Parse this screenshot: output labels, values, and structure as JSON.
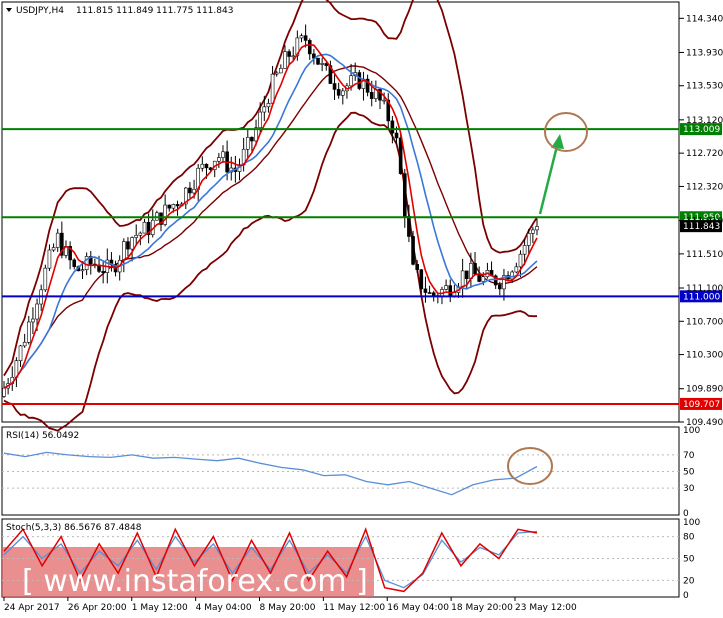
{
  "header": {
    "symbol": "USDJPY,H4",
    "ohlc": "111.815 111.849 111.775 111.843",
    "rsi": "RSI(14) 56.0492",
    "stoch": "Stoch(5,3,3) 86.5676 87.4848"
  },
  "watermark": "[ www.instaforex.com ]",
  "colors": {
    "resistance": "#008000",
    "support_blue": "#0000c8",
    "support_red": "#e00000",
    "candle": "#000000",
    "ma_fast": "#e00000",
    "ma_slow": "#3a78d8",
    "bollinger": "#7a0000",
    "rsi_line": "#5a8fd6",
    "stoch_main": "#e00000",
    "stoch_signal": "#5a8fd6",
    "arrow": "#22aa44",
    "circle": "#b07850",
    "watermark_band": "#e06060"
  },
  "chart_data": {
    "type": "candlestick",
    "price_axis": {
      "ylim": [
        109.49,
        114.5
      ],
      "ticks": [
        "114.340",
        "113.930",
        "113.530",
        "113.120",
        "112.720",
        "112.320",
        "111.910",
        "111.510",
        "111.100",
        "110.700",
        "110.300",
        "109.890",
        "109.490"
      ]
    },
    "levels": [
      {
        "value": 113.009,
        "label": "113.009",
        "color_key": "resistance"
      },
      {
        "value": 111.95,
        "label": "111.950",
        "color_key": "resistance"
      },
      {
        "value": 111.843,
        "label": "111.843",
        "color_key": "current"
      },
      {
        "value": 111.0,
        "label": "111.000",
        "color_key": "support_blue"
      },
      {
        "value": 109.707,
        "label": "109.707",
        "color_key": "support_red"
      }
    ],
    "x_labels": [
      "24 Apr 2017",
      "26 Apr 20:00",
      "1 May 12:00",
      "4 May 04:00",
      "8 May 20:00",
      "11 May 12:00",
      "16 May 04:00",
      "18 May 20:00",
      "23 May 12:00"
    ],
    "close_path": [
      109.9,
      110.4,
      111.1,
      111.7,
      111.3,
      111.4,
      111.3,
      111.7,
      111.8,
      112.0,
      112.2,
      112.5,
      112.7,
      112.5,
      112.9,
      113.5,
      113.9,
      114.1,
      113.7,
      113.5,
      113.6,
      113.4,
      113.0,
      111.3,
      111.0,
      111.1,
      111.3,
      111.2,
      111.2,
      111.5,
      111.9
    ],
    "rsi": {
      "label": "RSI(14) 56.0492",
      "ylim": [
        0,
        100
      ],
      "ticks": [
        "100",
        "70",
        "50",
        "30",
        "0"
      ],
      "values": [
        72,
        68,
        73,
        70,
        68,
        67,
        70,
        66,
        67,
        65,
        63,
        66,
        60,
        55,
        52,
        45,
        46,
        38,
        34,
        38,
        30,
        22,
        34,
        40,
        42,
        56
      ]
    },
    "stoch": {
      "label": "Stoch(5,3,3) 86.5676 87.4848",
      "ylim": [
        0,
        100
      ],
      "ticks": [
        "100",
        "80",
        "50",
        "20",
        "0"
      ],
      "main": [
        60,
        90,
        40,
        80,
        20,
        70,
        30,
        85,
        25,
        90,
        40,
        80,
        20,
        75,
        30,
        85,
        20,
        60,
        25,
        90,
        10,
        5,
        30,
        85,
        40,
        70,
        50,
        90,
        85
      ],
      "signal": [
        55,
        80,
        50,
        70,
        30,
        60,
        40,
        75,
        35,
        80,
        45,
        70,
        30,
        65,
        35,
        75,
        30,
        55,
        30,
        80,
        20,
        10,
        28,
        75,
        45,
        65,
        55,
        85,
        87
      ]
    }
  }
}
